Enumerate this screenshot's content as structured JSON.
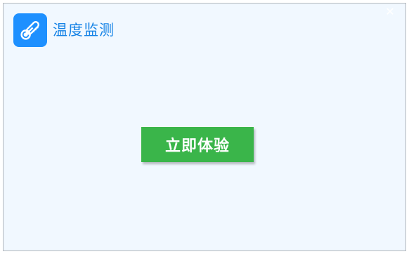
{
  "app": {
    "title": "温度监测",
    "logo_icon": "thermometer-icon",
    "logo_color": "#1e90ff",
    "title_color": "#1683e6"
  },
  "window": {
    "close_icon": "close-icon",
    "close_glyph": "✕",
    "background": "#f1f8ff"
  },
  "main": {
    "cta_label": "立即体验",
    "cta_color": "#3ab54a"
  }
}
